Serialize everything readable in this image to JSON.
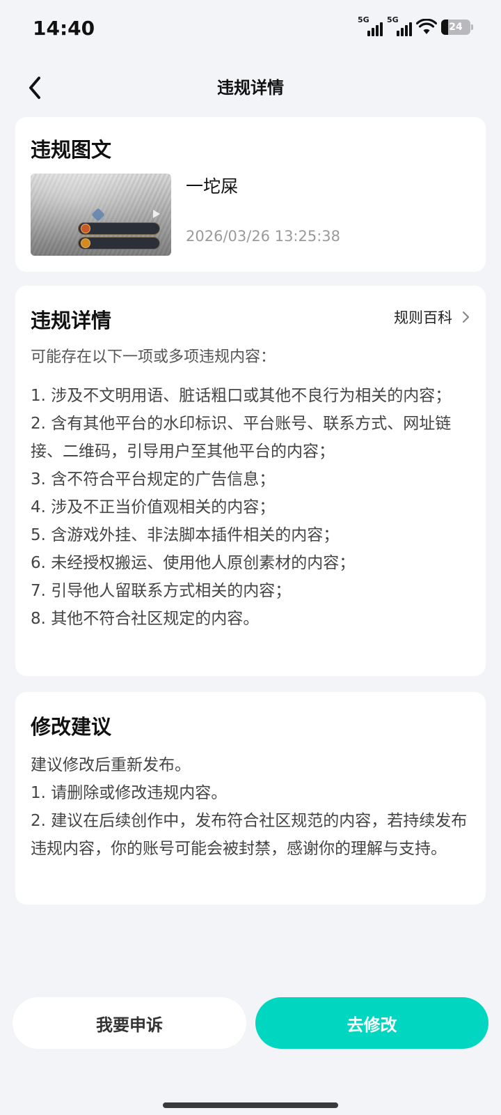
{
  "status_bar": {
    "time": "14:40",
    "network1": "5G",
    "network2": "5G",
    "battery": "24"
  },
  "nav": {
    "title": "违规详情",
    "back_icon": "chevron-left-icon"
  },
  "post_card": {
    "title": "违规图文",
    "post_title": "一坨屎",
    "post_time": "2026/03/26 13:25:38"
  },
  "detail_card": {
    "title": "违规详情",
    "rules_link": "规则百科",
    "intro": "可能存在以下一项或多项违规内容：",
    "items": [
      "1. 涉及不文明用语、脏话粗口或其他不良行为相关的内容；",
      "2. 含有其他平台的水印标识、平台账号、联系方式、网址链接、二维码，引导用户至其他平台的内容；",
      "3. 含不符合平台规定的广告信息；",
      "4. 涉及不正当价值观相关的内容；",
      "5. 含游戏外挂、非法脚本插件相关的内容；",
      "6. 未经授权搬运、使用他人原创素材的内容；",
      "7. 引导他人留联系方式相关的内容；",
      "8. 其他不符合社区规定的内容。"
    ]
  },
  "advice_card": {
    "title": "修改建议",
    "items": [
      "建议修改后重新发布。",
      "1. 请删除或修改违规内容。",
      "2. 建议在后续创作中，发布符合社区规范的内容，若持续发布违规内容，你的账号可能会被封禁，感谢你的理解与支持。"
    ]
  },
  "buttons": {
    "appeal": "我要申诉",
    "edit": "去修改"
  },
  "colors": {
    "background": "#f3f4f8",
    "accent": "#00d6c0",
    "muted_text": "#9a9a9a"
  }
}
